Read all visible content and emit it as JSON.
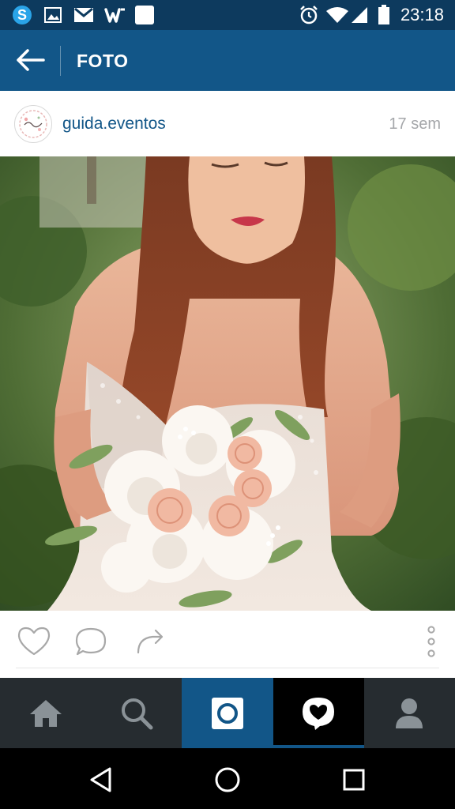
{
  "status_bar": {
    "time": "23:18",
    "icons": [
      "skype-icon",
      "gallery-icon",
      "gmail-icon",
      "wattpad-icon",
      "blank-app-icon",
      "alarm-icon",
      "wifi-icon",
      "signal-icon",
      "battery-icon"
    ]
  },
  "app_bar": {
    "title": "FOTO",
    "back_icon": "arrow-back-icon"
  },
  "post": {
    "username": "guida.eventos",
    "time_ago": "17 sem",
    "avatar_icon": "guida-eventos-logo"
  },
  "actions": [
    "like-icon",
    "comment-icon",
    "share-icon",
    "more-options-icon"
  ],
  "tabs": [
    "home-icon",
    "search-icon",
    "camera-icon",
    "activity-icon",
    "profile-icon"
  ],
  "nav": [
    "back-triangle-icon",
    "home-circle-icon",
    "recents-square-icon"
  ],
  "colors": {
    "status_bar": "#0d3a5e",
    "app_bar": "#125688",
    "username": "#125688",
    "tab_bar": "#262c30",
    "active_tab": "#125688"
  }
}
